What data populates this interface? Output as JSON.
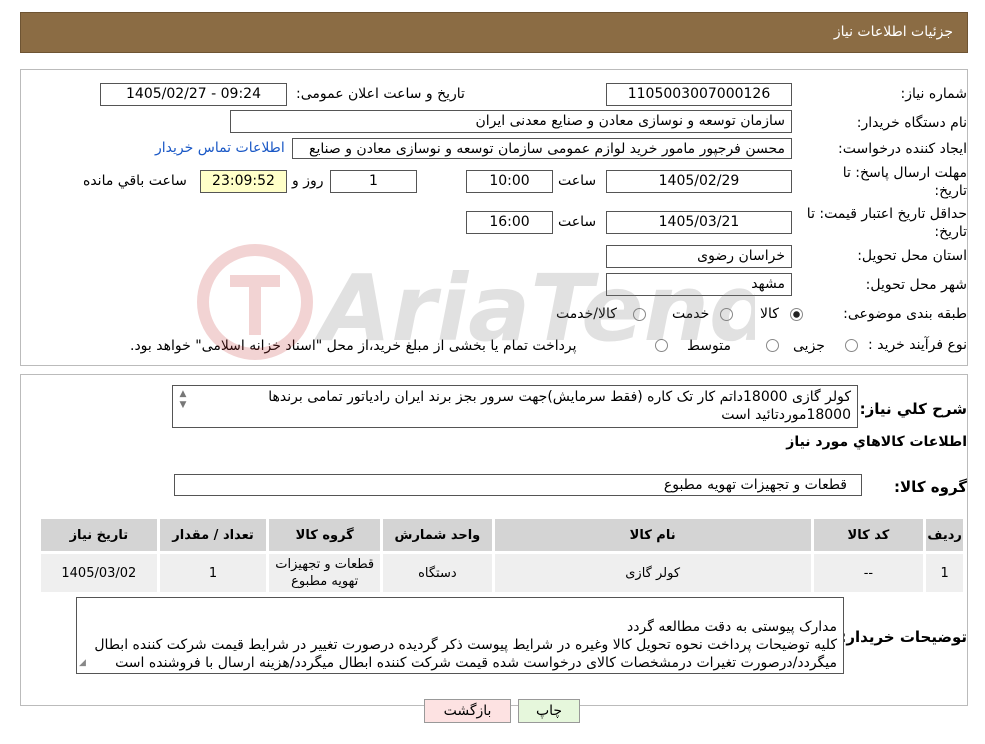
{
  "header": {
    "title": "جزئیات اطلاعات نیاز"
  },
  "form": {
    "need_number_label": "شماره نیاز:",
    "need_number": "1105003007000126",
    "announce_label": "تاریخ و ساعت اعلان عمومی:",
    "announce_value": "1405/02/27 - 09:24",
    "buyer_org_label": "نام دستگاه خریدار:",
    "buyer_org": "سازمان توسعه و نوسازی معادن و صنایع معدنی ایران",
    "requester_label": "ایجاد کننده درخواست:",
    "requester": "محسن فرجپور مامور خرید لوازم عمومی سازمان توسعه و نوسازی معادن و صنایع",
    "contact_link": "اطلاعات تماس خریدار",
    "deadline_label_1": "مهلت ارسال پاسخ: تا",
    "deadline_label_2": "تاریخ:",
    "deadline_date": "1405/02/29",
    "time_label": "ساعت",
    "deadline_time": "10:00",
    "days_value": "1",
    "days_label": "روز و",
    "remaining_time": "23:09:52",
    "remaining_label": "ساعت باقي مانده",
    "validity_label_1": "حداقل تاریخ اعتبار قیمت: تا",
    "validity_label_2": "تاریخ:",
    "validity_date": "1405/03/21",
    "validity_time": "16:00",
    "province_label": "استان محل تحویل:",
    "province": "خراسان رضوی",
    "city_label": "شهر محل تحویل:",
    "city": "مشهد",
    "category_label": "طبقه بندی موضوعی:",
    "category_options": [
      "کالا",
      "خدمت",
      "کالا/خدمت"
    ],
    "process_label": "نوع فرآیند خرید :",
    "process_options": [
      "جزیی",
      "متوسط"
    ],
    "process_note": "پرداخت تمام یا بخشی از مبلغ خرید،از محل \"اسناد خزانه اسلامی\" خواهد بود."
  },
  "details": {
    "description_label": "شرح کلي نياز:",
    "description": "کولر گازی 18000داتم کار تک کاره (فقط سرمایش)جهت سرور بجز برند ایران رادیاتور تمامی برندها 18000موردتائید است",
    "goods_info_title": "اطلاعات کالاهاي مورد نياز",
    "goods_group_label": "گروه کالا:",
    "goods_group": "قطعات و تجهیزات تهویه مطبوع",
    "table": {
      "headers": [
        "رديف",
        "کد کالا",
        "نام کالا",
        "واحد شمارش",
        "گروه کالا",
        "تعداد / مقدار",
        "تاريخ نياز"
      ],
      "rows": [
        [
          "1",
          "--",
          "کولر گازی",
          "دستگاه",
          "قطعات و تجهیزات تهویه مطبوع",
          "1",
          "1405/03/02"
        ]
      ]
    },
    "buyer_notes_label": "توضیحات خریدار:",
    "buyer_notes": "مدارک پیوستی به دقت مطالعه گردد\nکلیه توضیحات پرداخت نحوه تحویل کالا وغیره در شرایط پیوست ذکر گردیده درصورت تغییر در شرایط  قیمت شرکت کننده ابطال میگردد/درصورت تغیرات درمشخصات کالای درخواست شده قیمت شرکت کننده ابطال میگردد/هزینه ارسال با فروشنده است"
  },
  "buttons": {
    "print": "چاپ",
    "back": "بازگشت"
  },
  "colors": {
    "header_bg": "#8b6c44",
    "print_bg": "#e6f7dc",
    "back_bg": "#fde2e2",
    "remaining_bg": "#ffffc8"
  }
}
